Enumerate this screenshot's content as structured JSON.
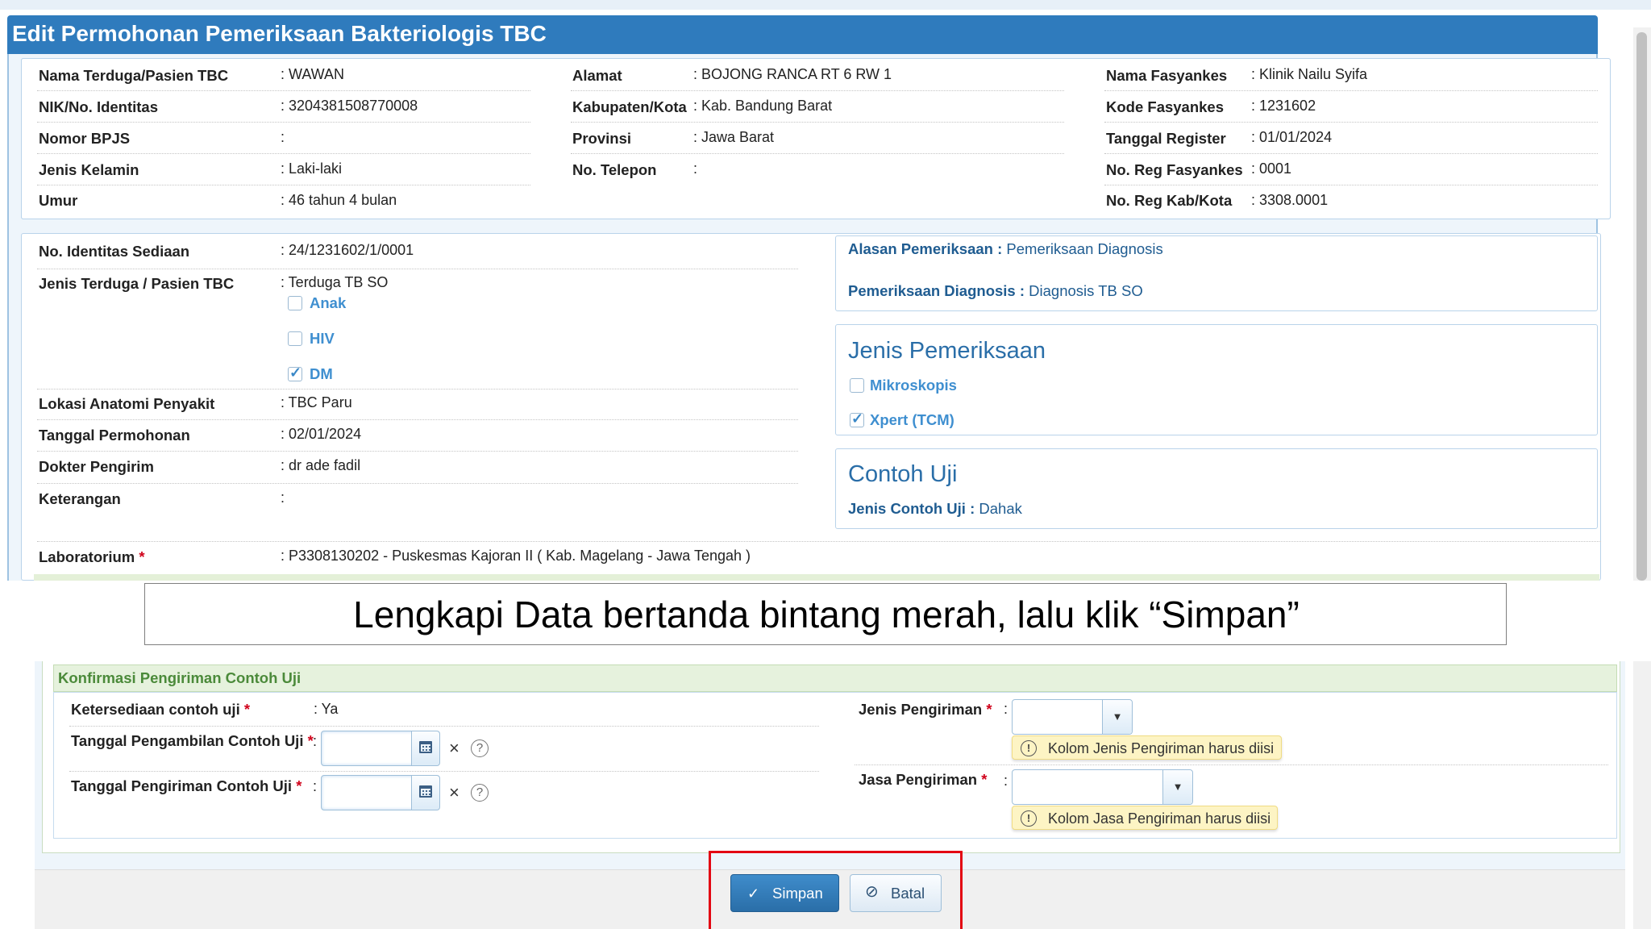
{
  "title": "Edit Permohonan Pemeriksaan Bakteriologis TBC",
  "patient": {
    "col1": [
      {
        "label": "Nama Terduga/Pasien TBC",
        "value": ": WAWAN"
      },
      {
        "label": "NIK/No. Identitas",
        "value": ": 3204381508770008"
      },
      {
        "label": "Nomor BPJS",
        "value": ":"
      },
      {
        "label": "Jenis Kelamin",
        "value": ": Laki-laki"
      },
      {
        "label": "Umur",
        "value": ": 46 tahun 4 bulan"
      }
    ],
    "col2": [
      {
        "label": "Alamat",
        "value": ": BOJONG RANCA RT 6 RW 1"
      },
      {
        "label": "Kabupaten/Kota",
        "value": ": Kab. Bandung Barat"
      },
      {
        "label": "Provinsi",
        "value": ": Jawa Barat"
      },
      {
        "label": "No. Telepon",
        "value": ":"
      }
    ],
    "col3": [
      {
        "label": "Nama Fasyankes",
        "value": ": Klinik Nailu Syifa"
      },
      {
        "label": "Kode Fasyankes",
        "value": ": 1231602"
      },
      {
        "label": "Tanggal Register",
        "value": ": 01/01/2024"
      },
      {
        "label": "No. Reg Fasyankes",
        "value": ": 0001"
      },
      {
        "label": "No. Reg Kab/Kota",
        "value": ": 3308.0001"
      }
    ]
  },
  "sample": {
    "no_identitas_label": "No. Identitas Sediaan",
    "no_identitas_value": ": 24/1231602/1/0001",
    "jenis_terduga_label": "Jenis Terduga / Pasien TBC",
    "jenis_terduga_value": ": Terduga TB SO",
    "checkboxes": [
      {
        "label": "Anak",
        "checked": false
      },
      {
        "label": "HIV",
        "checked": false
      },
      {
        "label": "DM",
        "checked": true
      }
    ],
    "lokasi_label": "Lokasi Anatomi Penyakit",
    "lokasi_value": ": TBC Paru",
    "tanggal_label": "Tanggal Permohonan",
    "tanggal_value": ": 02/01/2024",
    "dokter_label": "Dokter Pengirim",
    "dokter_value": ": dr ade fadil",
    "keterangan_label": "Keterangan",
    "keterangan_value": ":",
    "lab_label": "Laboratorium",
    "lab_value": ": P3308130202 - Puskesmas Kajoran II ( Kab. Magelang - Jawa Tengah )"
  },
  "alasan": {
    "label1": "Alasan Pemeriksaan :",
    "value1": "Pemeriksaan Diagnosis",
    "label2": "Pemeriksaan Diagnosis :",
    "value2": "Diagnosis TB SO"
  },
  "jenis_pemeriksaan": {
    "heading": "Jenis Pemeriksaan",
    "options": [
      {
        "label": "Mikroskopis",
        "checked": false
      },
      {
        "label": "Xpert (TCM)",
        "checked": true
      }
    ]
  },
  "contoh_uji": {
    "heading": "Contoh Uji",
    "label": "Jenis Contoh Uji :",
    "value": "Dahak"
  },
  "banner": "Lengkapi Data bertanda bintang merah, lalu klik “Simpan”",
  "konfirmasi": {
    "heading": "Konfirmasi Pengiriman Contoh Uji",
    "ketersediaan_label": "Ketersediaan contoh uji",
    "ketersediaan_value": ": Ya",
    "tgl_ambil_label": "Tanggal Pengambilan Contoh Uji",
    "tgl_kirim_label": "Tanggal Pengiriman Contoh Uji",
    "colon": ":",
    "jenis_pengiriman_label": "Jenis Pengiriman",
    "jenis_pengiriman_warning": "Kolom Jenis Pengiriman harus diisi",
    "jasa_pengiriman_label": "Jasa Pengiriman",
    "jasa_pengiriman_warning": "Kolom Jasa Pengiriman harus diisi",
    "required_mark": "*",
    "clear_glyph": "×",
    "help_glyph": "?",
    "warn_glyph": "!",
    "dropdown_glyph": "▼"
  },
  "buttons": {
    "save": "Simpan",
    "cancel": "Batal",
    "check_glyph": "✓",
    "cancel_glyph": "⊘"
  },
  "colors": {
    "header_blue": "#2f7bbd",
    "required_red": "#d0021b",
    "checkbox_label_blue": "#3f8fd0",
    "highlight_frame": "#e30613",
    "warning_bg": "#fdf4c4"
  },
  "icons": [
    "calendar-icon",
    "clear-icon",
    "help-icon",
    "warning-icon",
    "dropdown-arrow-icon",
    "check-icon",
    "cancel-icon"
  ]
}
